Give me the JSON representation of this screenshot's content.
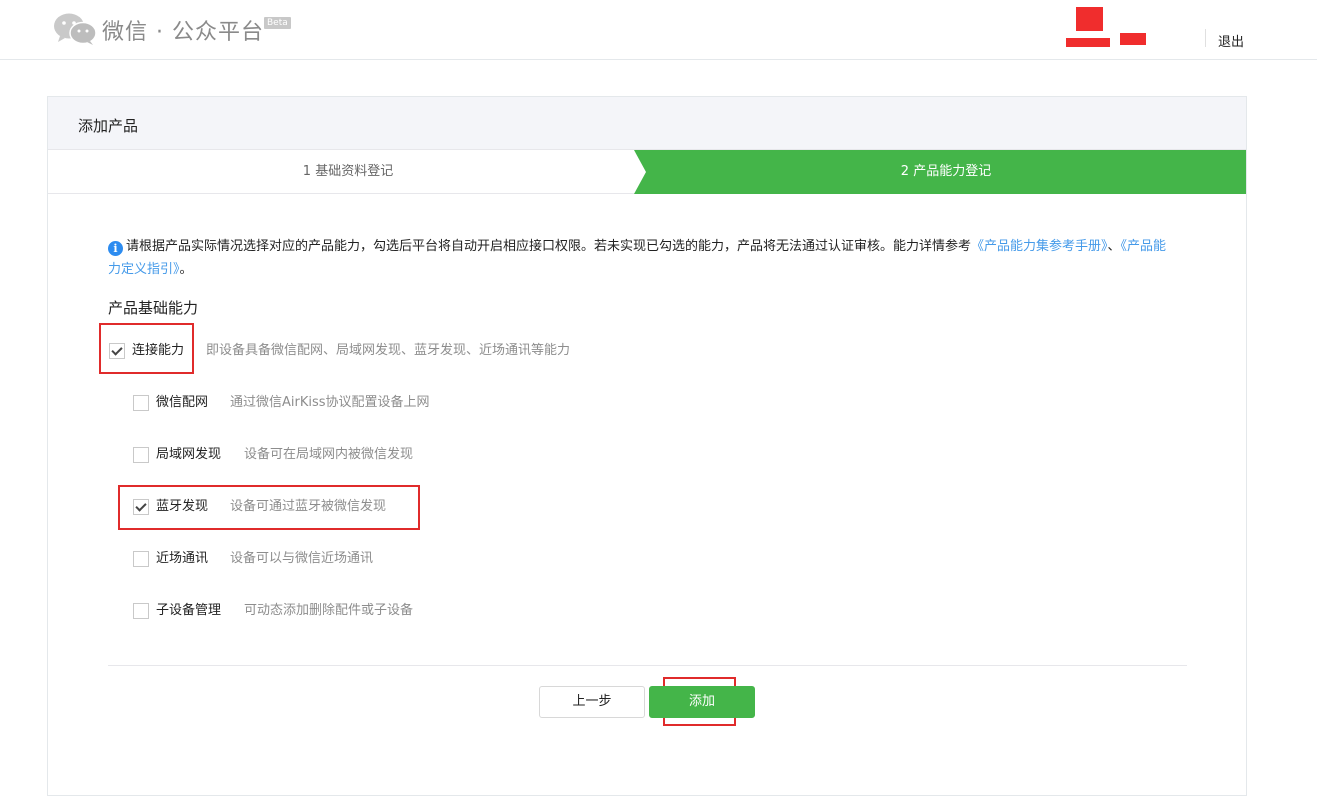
{
  "header": {
    "brand": "微信 · 公众平台",
    "beta": "Beta",
    "logout": "退出"
  },
  "panel": {
    "title": "添加产品"
  },
  "steps": [
    {
      "label": "1 基础资料登记"
    },
    {
      "label": "2 产品能力登记"
    }
  ],
  "notice": {
    "icon": "i",
    "text": "请根据产品实际情况选择对应的产品能力，勾选后平台将自动开启相应接口权限。若未实现已勾选的能力，产品将无法通过认证审核。能力详情参考",
    "link1": "《产品能力集参考手册》",
    "sep": "、",
    "link2": "《产品能力定义指引》",
    "end": "。"
  },
  "section": {
    "title": "产品基础能力"
  },
  "options": {
    "connect": {
      "label": "连接能力",
      "desc": "即设备具备微信配网、局域网发现、蓝牙发现、近场通讯等能力",
      "checked": true
    },
    "sub": [
      {
        "label": "微信配网",
        "desc": "通过微信AirKiss协议配置设备上网",
        "checked": false
      },
      {
        "label": "局域网发现",
        "desc": "设备可在局域网内被微信发现",
        "checked": false
      },
      {
        "label": "蓝牙发现",
        "desc": "设备可通过蓝牙被微信发现",
        "checked": true
      },
      {
        "label": "近场通讯",
        "desc": "设备可以与微信近场通讯",
        "checked": false
      },
      {
        "label": "子设备管理",
        "desc": "可动态添加删除配件或子设备",
        "checked": false
      }
    ]
  },
  "buttons": {
    "prev": "上一步",
    "add": "添加"
  },
  "colors": {
    "accent_green": "#44b549",
    "link_blue": "#459ae9",
    "highlight_red": "#e02b2b"
  }
}
